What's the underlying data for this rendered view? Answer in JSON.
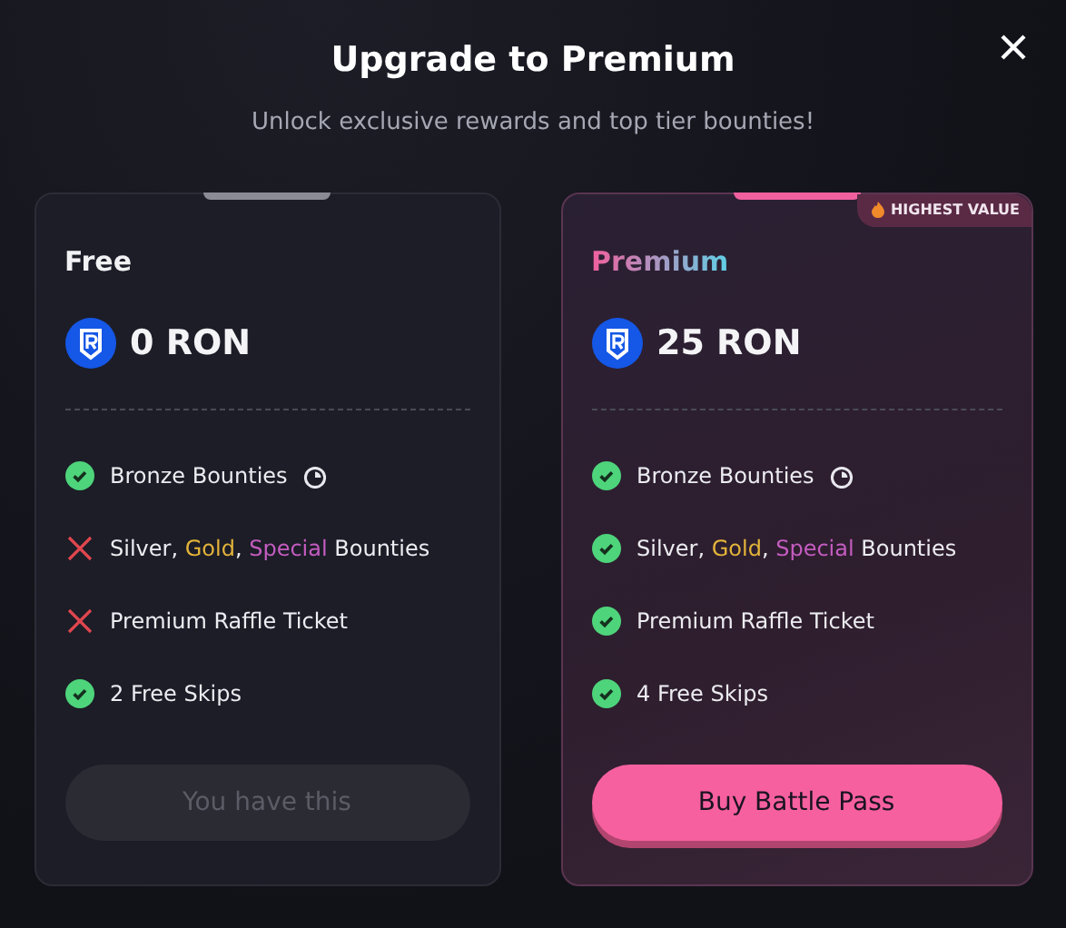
{
  "dialog": {
    "title": "Upgrade to Premium",
    "subtitle": "Unlock exclusive rewards and top tier bounties!"
  },
  "plans": [
    {
      "kind": "free",
      "name": "Free",
      "price": "0 RON",
      "features": [
        {
          "included": true,
          "has_timer": true,
          "parts": [
            {
              "kind": "plain",
              "text": "Bronze Bounties"
            }
          ]
        },
        {
          "included": false,
          "has_timer": false,
          "parts": [
            {
              "kind": "plain",
              "text": "Silver, "
            },
            {
              "kind": "gold",
              "text": "Gold"
            },
            {
              "kind": "plain",
              "text": ", "
            },
            {
              "kind": "special",
              "text": "Special"
            },
            {
              "kind": "plain",
              "text": " Bounties"
            }
          ]
        },
        {
          "included": false,
          "has_timer": false,
          "parts": [
            {
              "kind": "plain",
              "text": "Premium Raffle Ticket"
            }
          ]
        },
        {
          "included": true,
          "has_timer": false,
          "parts": [
            {
              "kind": "plain",
              "text": "2 Free Skips"
            }
          ]
        }
      ],
      "button": {
        "label": "You have this",
        "disabled": true
      }
    },
    {
      "kind": "premium",
      "name": "Premium",
      "price": "25 RON",
      "badge": "HIGHEST VALUE",
      "features": [
        {
          "included": true,
          "has_timer": true,
          "parts": [
            {
              "kind": "plain",
              "text": "Bronze Bounties"
            }
          ]
        },
        {
          "included": true,
          "has_timer": false,
          "parts": [
            {
              "kind": "plain",
              "text": "Silver, "
            },
            {
              "kind": "gold",
              "text": "Gold"
            },
            {
              "kind": "plain",
              "text": ", "
            },
            {
              "kind": "special",
              "text": "Special"
            },
            {
              "kind": "plain",
              "text": " Bounties"
            }
          ]
        },
        {
          "included": true,
          "has_timer": false,
          "parts": [
            {
              "kind": "plain",
              "text": "Premium Raffle Ticket"
            }
          ]
        },
        {
          "included": true,
          "has_timer": false,
          "parts": [
            {
              "kind": "plain",
              "text": "4 Free Skips"
            }
          ]
        }
      ],
      "button": {
        "label": "Buy Battle Pass",
        "disabled": false
      }
    }
  ]
}
